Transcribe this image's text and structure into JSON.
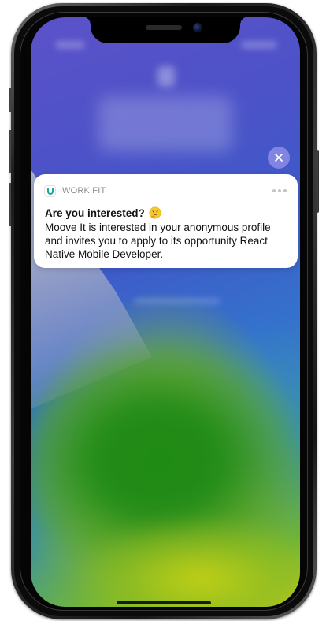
{
  "notification": {
    "app_name": "WORKIFIT",
    "title": "Are you interested?",
    "title_emoji": "thinking-face-icon",
    "body": "Moove It is interested in your anonymous profile and invites you to apply to its opportunity React Native Mobile Developer.",
    "app_icon": "workifit-logo-icon",
    "accent_color": "#1fa89a"
  },
  "controls": {
    "close_icon": "close-icon",
    "close_button_color": "#8c8ce6",
    "more_icon": "more-dots-icon"
  }
}
